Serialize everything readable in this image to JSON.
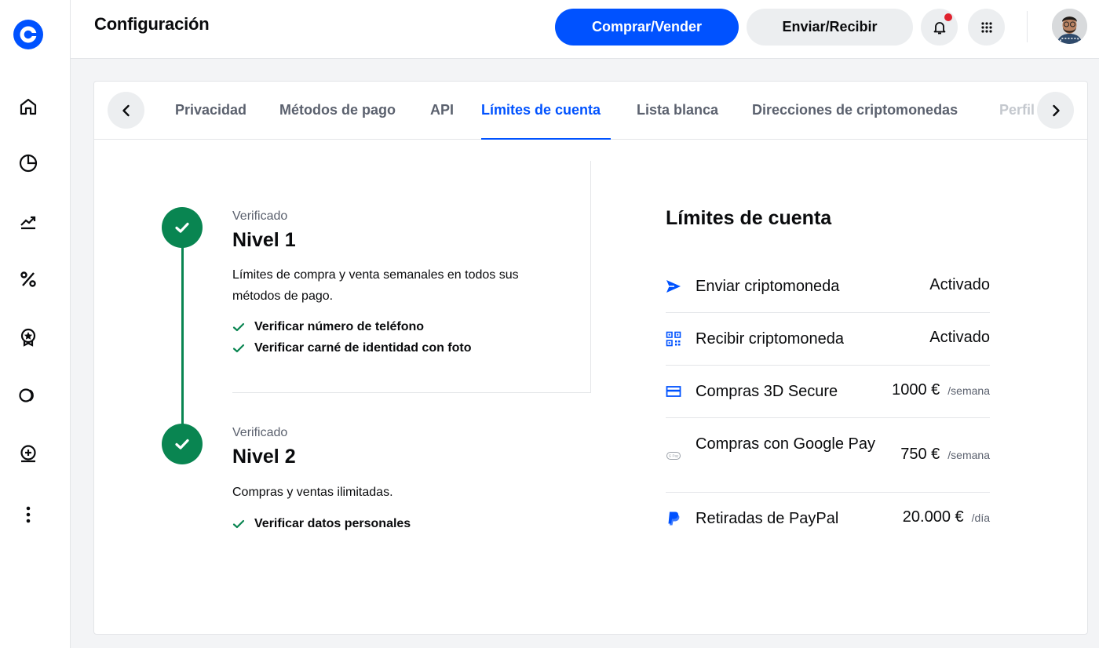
{
  "header": {
    "title": "Configuración",
    "buy_sell_label": "Comprar/Vender",
    "send_receive_label": "Enviar/Recibir"
  },
  "colors": {
    "brand": "#0052ff",
    "success": "#098551",
    "notification": "#e0222e"
  },
  "sidebar": {
    "items": [
      {
        "icon": "home-icon"
      },
      {
        "icon": "portfolio-icon"
      },
      {
        "icon": "trade-icon"
      },
      {
        "icon": "earn-icon"
      },
      {
        "icon": "learn-rewards-icon"
      },
      {
        "icon": "web3-icon"
      },
      {
        "icon": "card-icon"
      },
      {
        "icon": "more-icon"
      }
    ]
  },
  "tabs": {
    "items": [
      "Privacidad",
      "Métodos de pago",
      "API",
      "Límites de cuenta",
      "Lista blanca",
      "Direcciones de criptomonedas",
      "Perfil"
    ],
    "active": "Límites de cuenta"
  },
  "levels": [
    {
      "status": "Verificado",
      "title": "Nivel 1",
      "description": "Límites de compra y venta semanales en todos sus métodos de pago.",
      "requirements": [
        "Verificar número de teléfono",
        "Verificar carné de identidad con foto"
      ]
    },
    {
      "status": "Verificado",
      "title": "Nivel 2",
      "description": "Compras y ventas ilimitadas.",
      "requirements": [
        "Verificar datos personales"
      ]
    }
  ],
  "limits": {
    "title": "Límites de cuenta",
    "rows": [
      {
        "icon": "send-icon",
        "label": "Enviar criptomoneda",
        "value": "Activado",
        "unit": ""
      },
      {
        "icon": "qr-code-icon",
        "label": "Recibir criptomoneda",
        "value": "Activado",
        "unit": ""
      },
      {
        "icon": "credit-card-icon",
        "label": "Compras 3D Secure",
        "value": "1000 €",
        "unit": "/semana"
      },
      {
        "icon": "google-pay-icon",
        "label": "Compras con Google Pay",
        "value": "750 €",
        "unit": "/semana"
      },
      {
        "icon": "paypal-icon",
        "label": "Retiradas de PayPal",
        "value": "20.000 €",
        "unit": "/día"
      }
    ]
  }
}
